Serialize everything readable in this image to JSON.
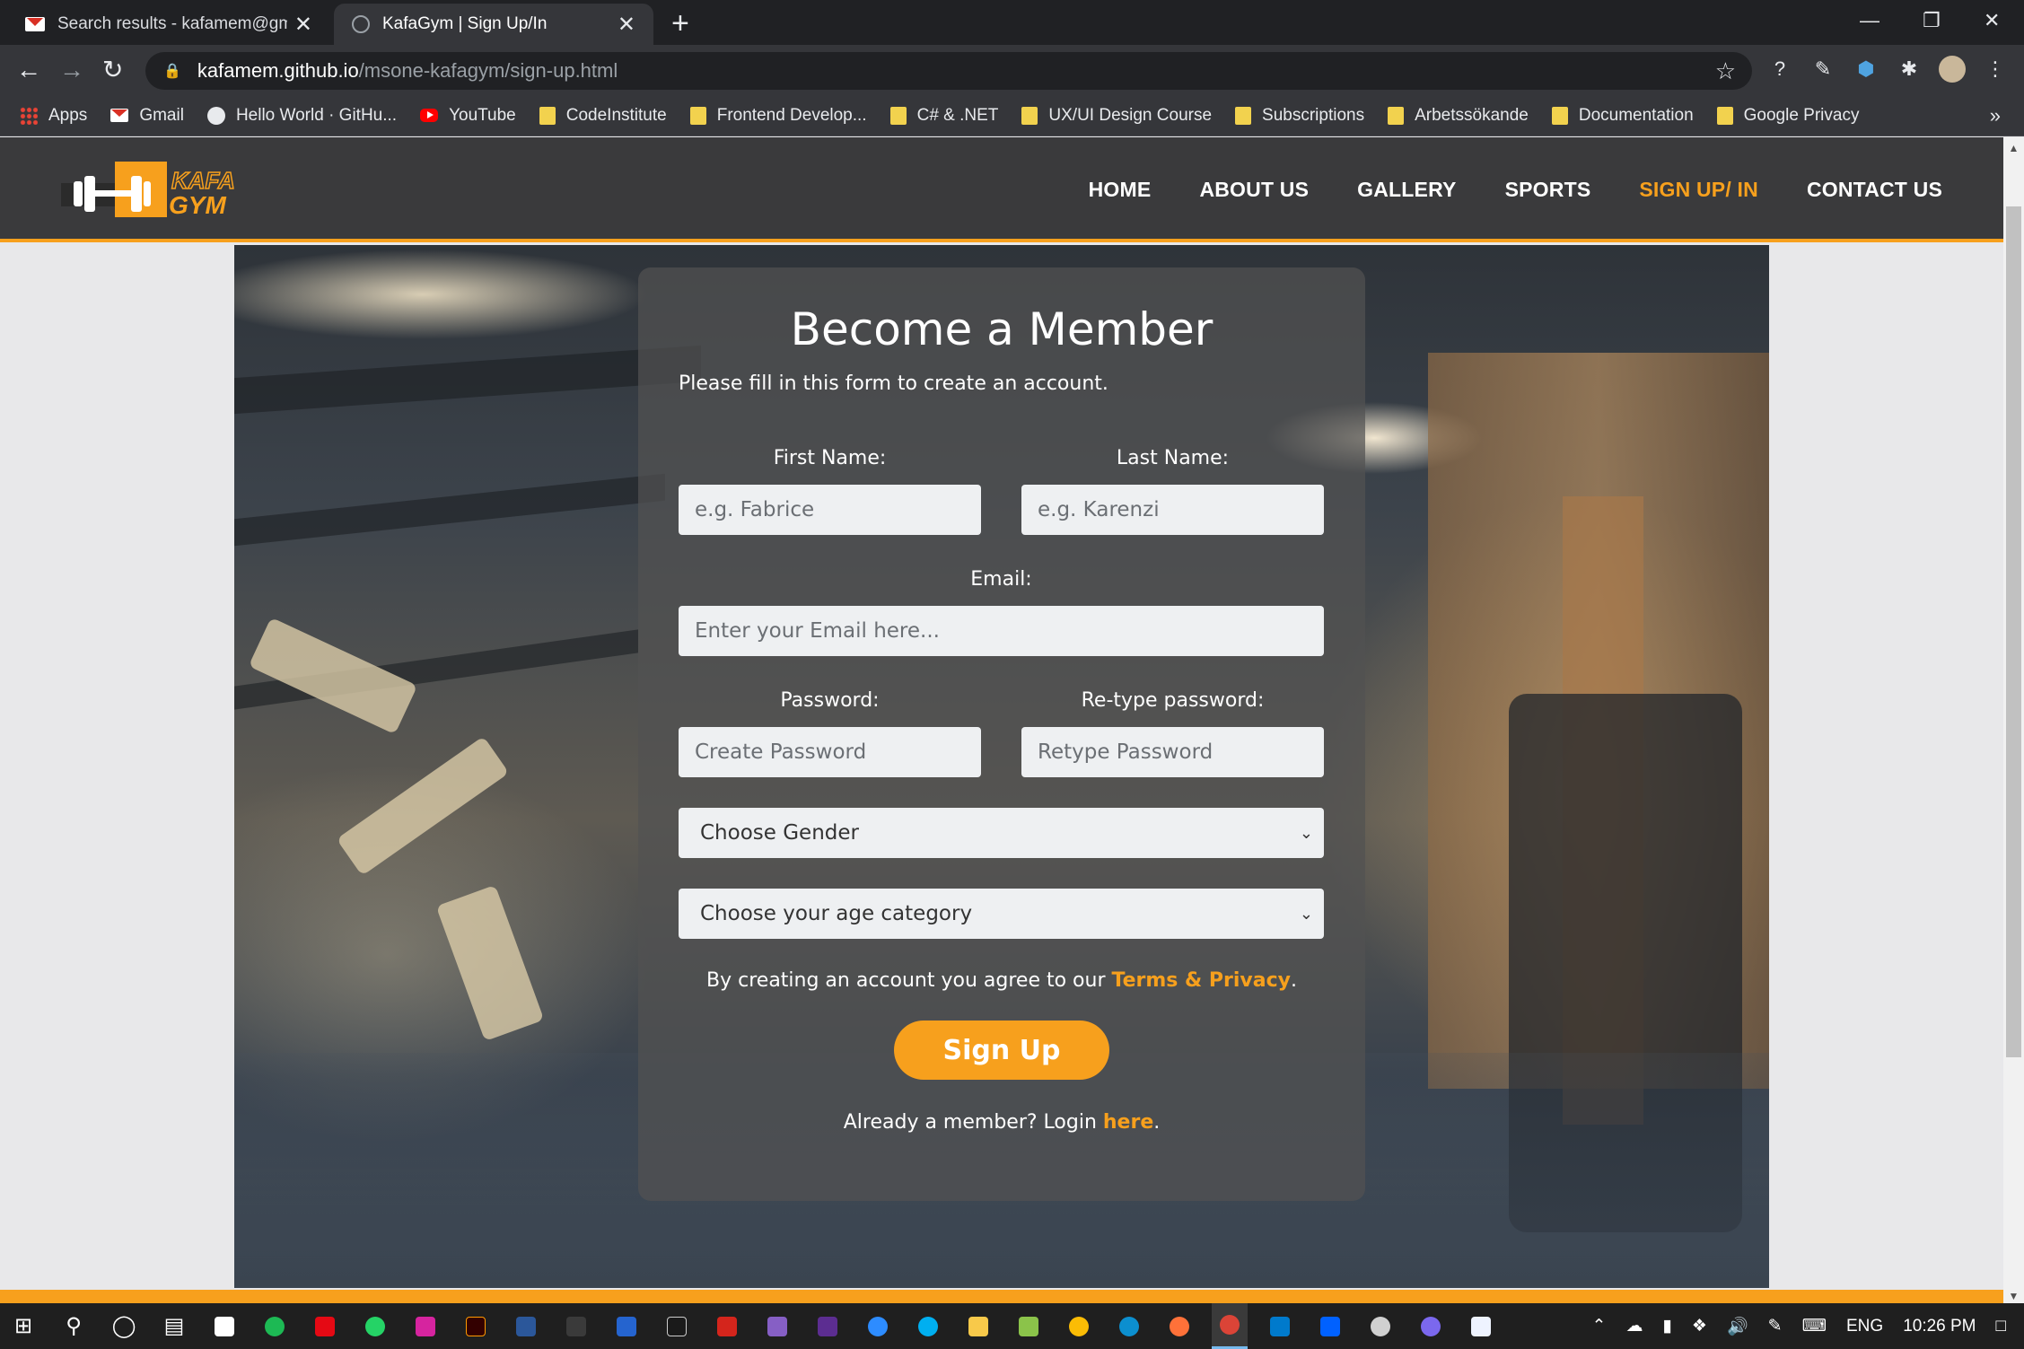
{
  "browser": {
    "tabs": [
      {
        "title": "Search results - kafamem@gmail",
        "close": "✕"
      },
      {
        "title": "KafaGym | Sign Up/In",
        "close": "✕"
      }
    ],
    "new_tab": "+",
    "address": {
      "host": "kafamem.github.io",
      "path": "/msone-kafagym/sign-up.html"
    },
    "bookmarks": [
      "Apps",
      "Gmail",
      "Hello World · GitHu...",
      "YouTube",
      "CodeInstitute",
      "Frontend Develop...",
      "C# & .NET",
      "UX/UI Design Course",
      "Subscriptions",
      "Arbetssökande",
      "Documentation",
      "Google Privacy"
    ],
    "bookmarks_more": "»"
  },
  "site": {
    "logo": {
      "text_top": "KAFA",
      "text_bottom": "GYM",
      "accent": "#f7a01d"
    },
    "nav": [
      "HOME",
      "ABOUT US",
      "GALLERY",
      "SPORTS",
      "SIGN UP/ IN",
      "CONTACT US"
    ],
    "active_nav": "SIGN UP/ IN"
  },
  "form": {
    "title": "Become a Member",
    "subtitle": "Please fill in this form to create an account.",
    "first_name": {
      "label": "First Name:",
      "placeholder": "e.g. Fabrice"
    },
    "last_name": {
      "label": "Last Name:",
      "placeholder": "e.g. Karenzi"
    },
    "email": {
      "label": "Email:",
      "placeholder": "Enter your Email here..."
    },
    "password": {
      "label": "Password:",
      "placeholder": "Create Password"
    },
    "retype": {
      "label": "Re-type password:",
      "placeholder": "Retype Password"
    },
    "gender": {
      "selected": "Choose Gender"
    },
    "age": {
      "selected": "Choose your age category"
    },
    "terms_prefix": "By creating an account you agree to our ",
    "terms_link": "Terms & Privacy",
    "terms_suffix": ".",
    "submit": "Sign Up",
    "login_prefix": "Already a member? Login ",
    "login_link": "here",
    "login_suffix": "."
  },
  "taskbar": {
    "lang": "ENG",
    "time": "10:26 PM"
  },
  "colors": {
    "accent": "#f7a01d",
    "header_bg": "#3a3a3c"
  }
}
